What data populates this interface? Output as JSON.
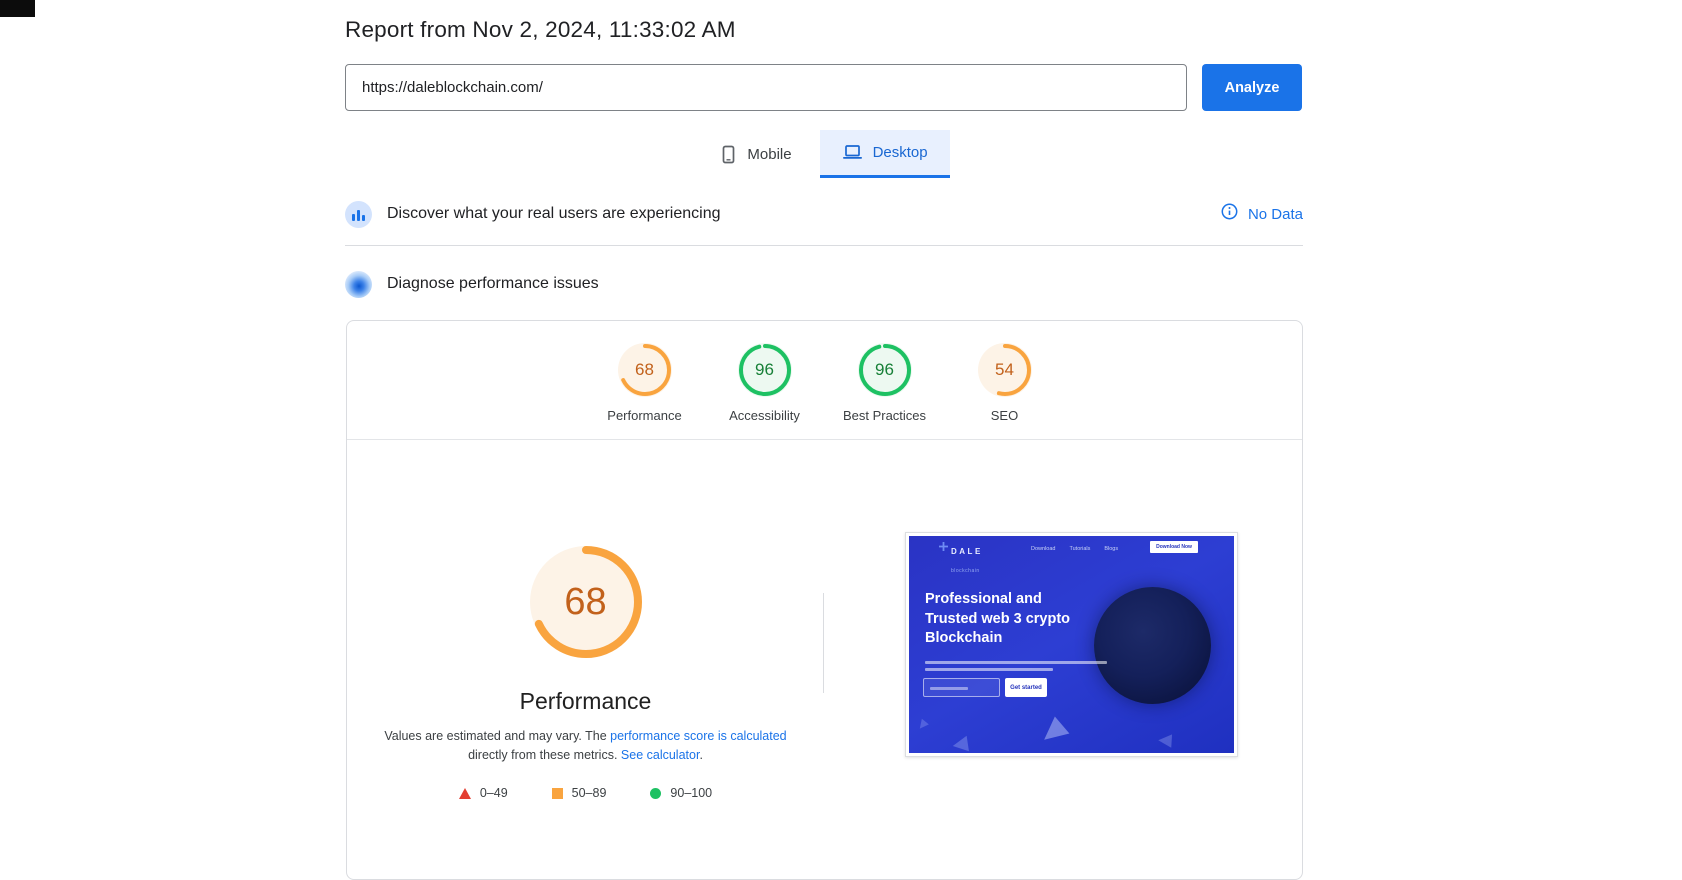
{
  "header": {
    "title": "Report from Nov 2, 2024, 11:33:02 AM"
  },
  "analyzer": {
    "url_value": "https://daleblockchain.com/",
    "analyze_label": "Analyze"
  },
  "tabs": {
    "mobile_label": "Mobile",
    "desktop_label": "Desktop",
    "selected": "Desktop"
  },
  "field_section": {
    "title": "Discover what your real users are experiencing",
    "status_label": "No Data"
  },
  "lab_section": {
    "title": "Diagnose performance issues"
  },
  "chart_data": {
    "type": "gauge",
    "categories": [
      "Performance",
      "Accessibility",
      "Best Practices",
      "SEO"
    ],
    "values": [
      68,
      96,
      96,
      54
    ],
    "levels": [
      "average",
      "good",
      "good",
      "average"
    ],
    "range_legend": [
      "0–49",
      "50–89",
      "90–100"
    ],
    "big_gauge": {
      "label": "Performance",
      "value": 68
    }
  },
  "scores": {
    "items": [
      {
        "label": "Performance",
        "value": 68,
        "level": "average"
      },
      {
        "label": "Accessibility",
        "value": 96,
        "level": "good"
      },
      {
        "label": "Best Practices",
        "value": 96,
        "level": "good"
      },
      {
        "label": "SEO",
        "value": 54,
        "level": "average"
      }
    ]
  },
  "performance_panel": {
    "score": 68,
    "title": "Performance",
    "disclaimer": [
      {
        "text": "Values are estimated and may vary. The ",
        "link": false
      },
      {
        "text": "performance score is calculated",
        "link": true
      },
      {
        "text": " directly from these metrics. ",
        "link": false
      },
      {
        "text": "See calculator",
        "link": true
      },
      {
        "text": ".",
        "link": false
      }
    ],
    "legend": [
      {
        "label": "0–49",
        "shape": "triangle",
        "color": "#e33e31"
      },
      {
        "label": "50–89",
        "shape": "square",
        "color": "#f9a43f"
      },
      {
        "label": "90–100",
        "shape": "circle",
        "color": "#1ec163"
      }
    ]
  },
  "site_preview": {
    "logo_text": "DALE",
    "logo_subtext": "blockchain",
    "nav_items": [
      "Download",
      "Tutorials",
      "Blogs"
    ],
    "top_cta_label": "Download Now",
    "heading_lines": [
      "Professional and",
      "Trusted web 3 crypto",
      "Blockchain"
    ],
    "cta_label": "Get started"
  },
  "colors": {
    "accent_blue": "#1a73e8",
    "tab_selected_bg": "#e8f0fe",
    "good_arc": "#1ec163",
    "good_text": "#188038",
    "good_bg": "#edf9f1",
    "average_arc": "#f9a43f",
    "average_text": "#c2611b",
    "average_bg": "#fdf3e7",
    "poor_red": "#e33e31"
  }
}
